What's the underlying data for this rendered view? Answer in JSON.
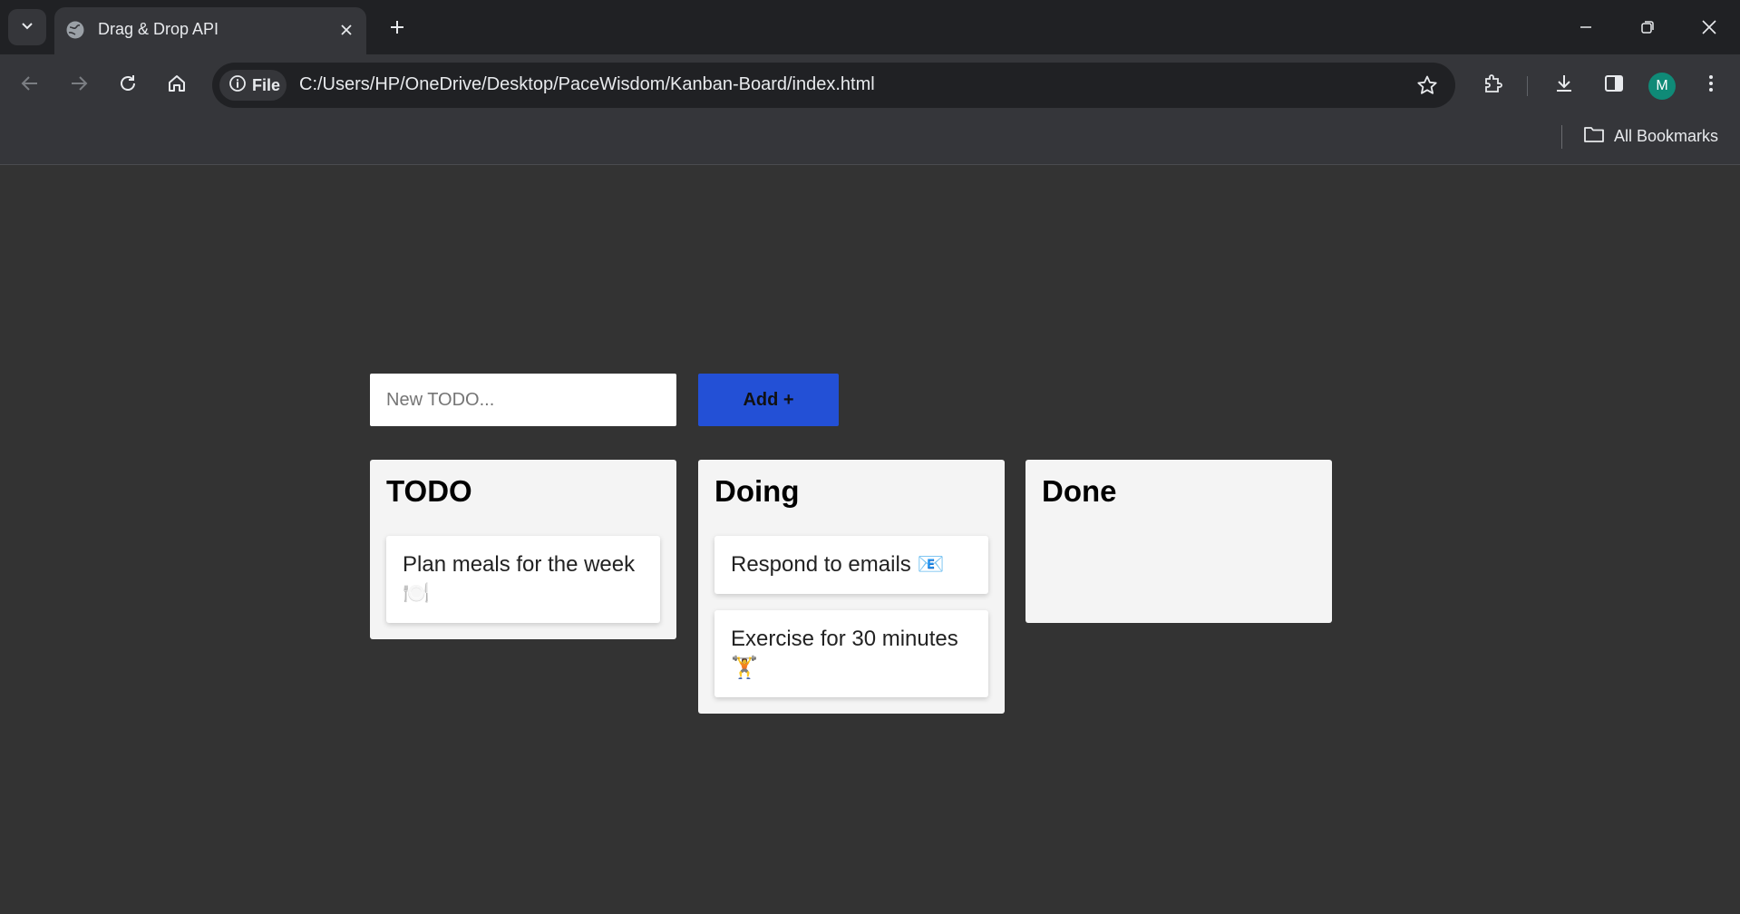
{
  "browser": {
    "tab_title": "Drag & Drop API",
    "url": "C:/Users/HP/OneDrive/Desktop/PaceWisdom/Kanban-Board/index.html",
    "site_chip_label": "File",
    "profile_initial": "M",
    "bookmarks_label": "All Bookmarks",
    "accent_profile_color": "#0f8a77"
  },
  "form": {
    "input_placeholder": "New TODO...",
    "input_value": "",
    "add_label": "Add +",
    "add_color": "#2350d6"
  },
  "lanes": [
    {
      "title": "TODO",
      "tasks": [
        "Plan meals for the week 🍽️"
      ]
    },
    {
      "title": "Doing",
      "tasks": [
        "Respond to emails 📧",
        "Exercise for 30 minutes 🏋️"
      ]
    },
    {
      "title": "Done",
      "tasks": []
    }
  ]
}
